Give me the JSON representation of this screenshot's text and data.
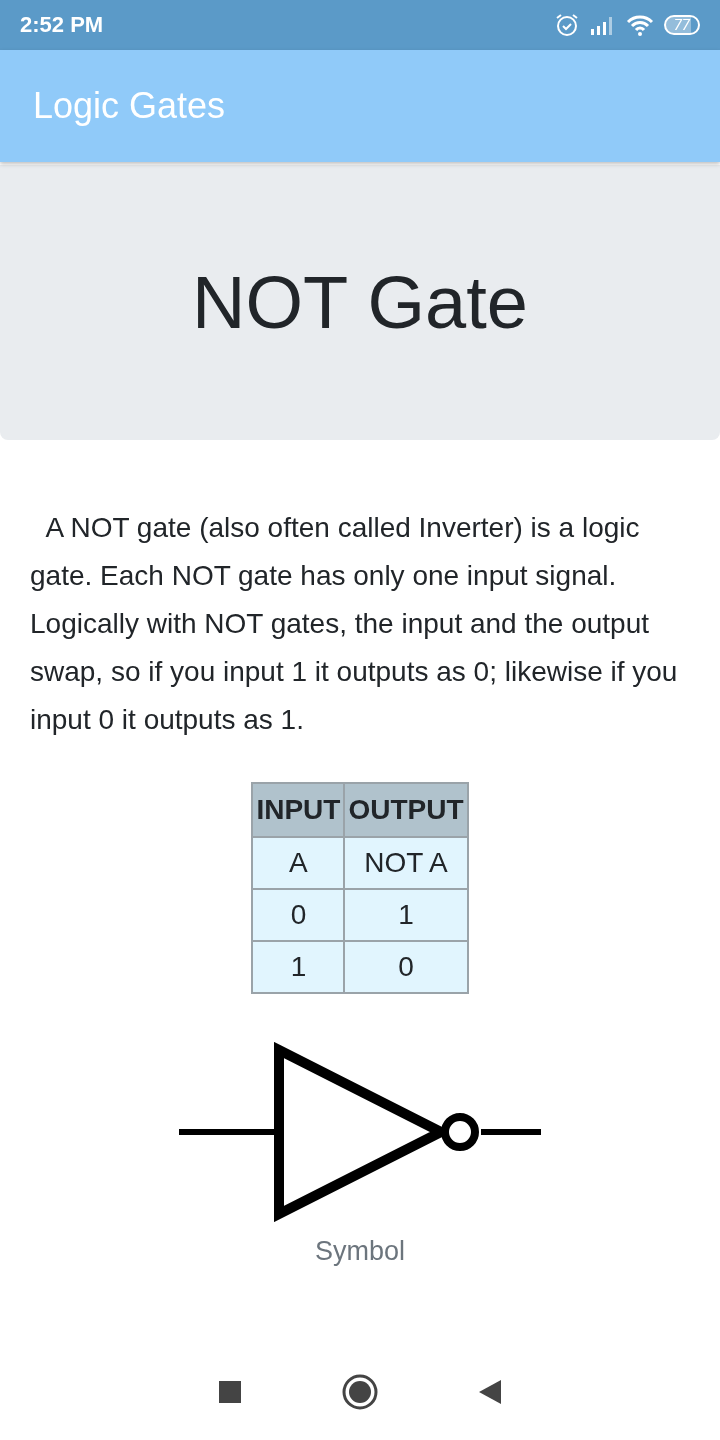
{
  "status_bar": {
    "time": "2:52 PM",
    "battery": "77"
  },
  "app_bar": {
    "title": "Logic Gates"
  },
  "header": {
    "title": "NOT Gate"
  },
  "description": "  A NOT gate (also often called Inverter) is a logic gate. Each NOT gate has only one input signal. Logically with NOT gates, the input and the output swap, so if you input 1 it outputs as 0; likewise if you input 0 it outputs as 1.",
  "truth_table": {
    "columns": [
      "INPUT",
      "OUTPUT"
    ],
    "rows": [
      [
        "A",
        "NOT A"
      ],
      [
        "0",
        "1"
      ],
      [
        "1",
        "0"
      ]
    ]
  },
  "symbol": {
    "caption": "Symbol"
  }
}
